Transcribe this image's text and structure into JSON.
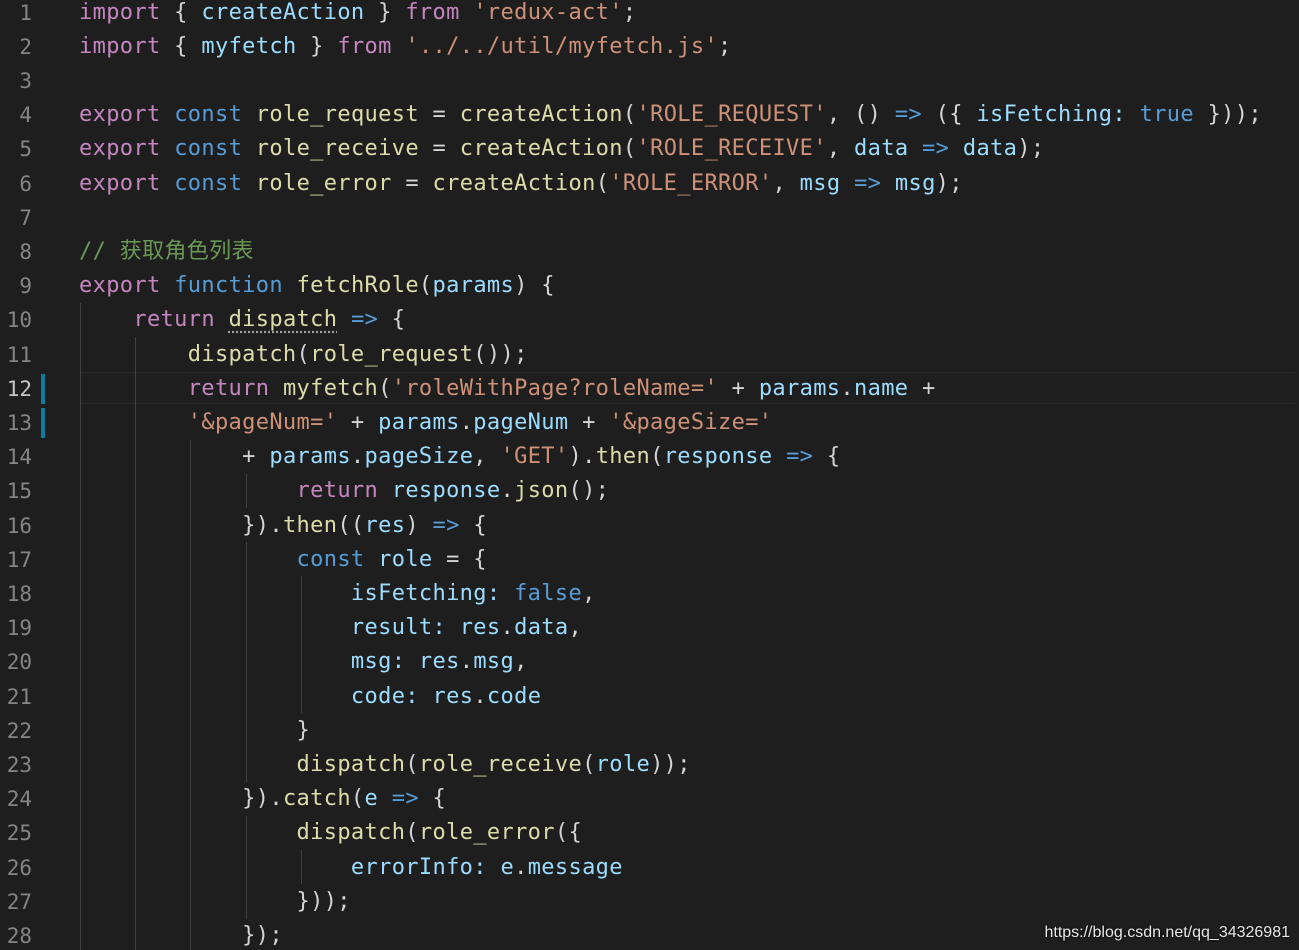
{
  "editor": {
    "language": "javascript",
    "theme_colors": {
      "background": "#1e1e1e",
      "line_number": "#858585",
      "keyword": "#c586c0",
      "storage": "#569cd6",
      "function": "#dcdcaa",
      "variable": "#9cdcfe",
      "string": "#ce9178",
      "comment": "#6a9955",
      "punctuation": "#d4d4d4",
      "modified_marker": "#0c7d9d"
    },
    "active_line": 12,
    "modified_lines": [
      12,
      13
    ],
    "lines": [
      {
        "n": "1",
        "tokens": [
          [
            "kw",
            "import"
          ],
          [
            "pun",
            " { "
          ],
          [
            "var",
            "createAction"
          ],
          [
            "pun",
            " } "
          ],
          [
            "kw",
            "from"
          ],
          [
            "pun",
            " "
          ],
          [
            "str",
            "'redux-act'"
          ],
          [
            "pun",
            ";"
          ]
        ]
      },
      {
        "n": "2",
        "tokens": [
          [
            "kw",
            "import"
          ],
          [
            "pun",
            " { "
          ],
          [
            "var",
            "myfetch"
          ],
          [
            "pun",
            " } "
          ],
          [
            "kw",
            "from"
          ],
          [
            "pun",
            " "
          ],
          [
            "str",
            "'../../util/myfetch.js'"
          ],
          [
            "pun",
            ";"
          ]
        ]
      },
      {
        "n": "3",
        "tokens": []
      },
      {
        "n": "4",
        "tokens": [
          [
            "kw",
            "export"
          ],
          [
            "pun",
            " "
          ],
          [
            "st",
            "const"
          ],
          [
            "pun",
            " "
          ],
          [
            "fn",
            "role_request"
          ],
          [
            "pun",
            " = "
          ],
          [
            "fn",
            "createAction"
          ],
          [
            "pun",
            "("
          ],
          [
            "str",
            "'ROLE_REQUEST'"
          ],
          [
            "pun",
            ", () "
          ],
          [
            "st",
            "=>"
          ],
          [
            "pun",
            " ({ "
          ],
          [
            "var",
            "isFetching"
          ],
          [
            "var",
            ":"
          ],
          [
            "pun",
            " "
          ],
          [
            "st",
            "true"
          ],
          [
            "pun",
            " }));"
          ]
        ]
      },
      {
        "n": "5",
        "tokens": [
          [
            "kw",
            "export"
          ],
          [
            "pun",
            " "
          ],
          [
            "st",
            "const"
          ],
          [
            "pun",
            " "
          ],
          [
            "fn",
            "role_receive"
          ],
          [
            "pun",
            " = "
          ],
          [
            "fn",
            "createAction"
          ],
          [
            "pun",
            "("
          ],
          [
            "str",
            "'ROLE_RECEIVE'"
          ],
          [
            "pun",
            ", "
          ],
          [
            "var",
            "data"
          ],
          [
            "pun",
            " "
          ],
          [
            "st",
            "=>"
          ],
          [
            "pun",
            " "
          ],
          [
            "var",
            "data"
          ],
          [
            "pun",
            ");"
          ]
        ]
      },
      {
        "n": "6",
        "tokens": [
          [
            "kw",
            "export"
          ],
          [
            "pun",
            " "
          ],
          [
            "st",
            "const"
          ],
          [
            "pun",
            " "
          ],
          [
            "fn",
            "role_error"
          ],
          [
            "pun",
            " = "
          ],
          [
            "fn",
            "createAction"
          ],
          [
            "pun",
            "("
          ],
          [
            "str",
            "'ROLE_ERROR'"
          ],
          [
            "pun",
            ", "
          ],
          [
            "var",
            "msg"
          ],
          [
            "pun",
            " "
          ],
          [
            "st",
            "=>"
          ],
          [
            "pun",
            " "
          ],
          [
            "var",
            "msg"
          ],
          [
            "pun",
            ");"
          ]
        ]
      },
      {
        "n": "7",
        "tokens": []
      },
      {
        "n": "8",
        "tokens": [
          [
            "cmt",
            "// 获取角色列表"
          ]
        ]
      },
      {
        "n": "9",
        "tokens": [
          [
            "kw",
            "export"
          ],
          [
            "pun",
            " "
          ],
          [
            "st",
            "function"
          ],
          [
            "pun",
            " "
          ],
          [
            "fn",
            "fetchRole"
          ],
          [
            "pun",
            "("
          ],
          [
            "var",
            "params"
          ],
          [
            "pun",
            ") {"
          ]
        ]
      },
      {
        "n": "10",
        "tokens": [
          [
            "pun",
            "    "
          ],
          [
            "kw",
            "return"
          ],
          [
            "pun",
            " "
          ],
          [
            "fn sq",
            "dispatch"
          ],
          [
            "pun",
            " "
          ],
          [
            "st",
            "=>"
          ],
          [
            "pun",
            " {"
          ]
        ]
      },
      {
        "n": "11",
        "tokens": [
          [
            "pun",
            "        "
          ],
          [
            "fn",
            "dispatch"
          ],
          [
            "pun",
            "("
          ],
          [
            "fn",
            "role_request"
          ],
          [
            "pun",
            "());"
          ]
        ]
      },
      {
        "n": "12",
        "tokens": [
          [
            "pun",
            "        "
          ],
          [
            "kw",
            "return"
          ],
          [
            "pun",
            " "
          ],
          [
            "fn",
            "myfetch"
          ],
          [
            "pun",
            "("
          ],
          [
            "str",
            "'roleWithPage?roleName='"
          ],
          [
            "pun",
            " + "
          ],
          [
            "var",
            "params"
          ],
          [
            "pun",
            "."
          ],
          [
            "var",
            "name"
          ],
          [
            "pun",
            " +"
          ]
        ]
      },
      {
        "n": "13",
        "tokens": [
          [
            "pun",
            "        "
          ],
          [
            "str",
            "'&pageNum='"
          ],
          [
            "pun",
            " + "
          ],
          [
            "var",
            "params"
          ],
          [
            "pun",
            "."
          ],
          [
            "var",
            "pageNum"
          ],
          [
            "pun",
            " + "
          ],
          [
            "str",
            "'&pageSize='"
          ]
        ]
      },
      {
        "n": "14",
        "tokens": [
          [
            "pun",
            "            + "
          ],
          [
            "var",
            "params"
          ],
          [
            "pun",
            "."
          ],
          [
            "var",
            "pageSize"
          ],
          [
            "pun",
            ", "
          ],
          [
            "str",
            "'GET'"
          ],
          [
            "pun",
            ")."
          ],
          [
            "fn",
            "then"
          ],
          [
            "pun",
            "("
          ],
          [
            "var",
            "response"
          ],
          [
            "pun",
            " "
          ],
          [
            "st",
            "=>"
          ],
          [
            "pun",
            " {"
          ]
        ]
      },
      {
        "n": "15",
        "tokens": [
          [
            "pun",
            "                "
          ],
          [
            "kw",
            "return"
          ],
          [
            "pun",
            " "
          ],
          [
            "var",
            "response"
          ],
          [
            "pun",
            "."
          ],
          [
            "fn",
            "json"
          ],
          [
            "pun",
            "();"
          ]
        ]
      },
      {
        "n": "16",
        "tokens": [
          [
            "pun",
            "            })."
          ],
          [
            "fn",
            "then"
          ],
          [
            "pun",
            "(("
          ],
          [
            "var",
            "res"
          ],
          [
            "pun",
            ") "
          ],
          [
            "st",
            "=>"
          ],
          [
            "pun",
            " {"
          ]
        ]
      },
      {
        "n": "17",
        "tokens": [
          [
            "pun",
            "                "
          ],
          [
            "st",
            "const"
          ],
          [
            "pun",
            " "
          ],
          [
            "var",
            "role"
          ],
          [
            "pun",
            " = {"
          ]
        ]
      },
      {
        "n": "18",
        "tokens": [
          [
            "pun",
            "                    "
          ],
          [
            "var",
            "isFetching"
          ],
          [
            "var",
            ":"
          ],
          [
            "pun",
            " "
          ],
          [
            "st",
            "false"
          ],
          [
            "pun",
            ","
          ]
        ]
      },
      {
        "n": "19",
        "tokens": [
          [
            "pun",
            "                    "
          ],
          [
            "var",
            "result"
          ],
          [
            "var",
            ":"
          ],
          [
            "pun",
            " "
          ],
          [
            "var",
            "res"
          ],
          [
            "pun",
            "."
          ],
          [
            "var",
            "data"
          ],
          [
            "pun",
            ","
          ]
        ]
      },
      {
        "n": "20",
        "tokens": [
          [
            "pun",
            "                    "
          ],
          [
            "var",
            "msg"
          ],
          [
            "var",
            ":"
          ],
          [
            "pun",
            " "
          ],
          [
            "var",
            "res"
          ],
          [
            "pun",
            "."
          ],
          [
            "var",
            "msg"
          ],
          [
            "pun",
            ","
          ]
        ]
      },
      {
        "n": "21",
        "tokens": [
          [
            "pun",
            "                    "
          ],
          [
            "var",
            "code"
          ],
          [
            "var",
            ":"
          ],
          [
            "pun",
            " "
          ],
          [
            "var",
            "res"
          ],
          [
            "pun",
            "."
          ],
          [
            "var",
            "code"
          ]
        ]
      },
      {
        "n": "22",
        "tokens": [
          [
            "pun",
            "                }"
          ]
        ]
      },
      {
        "n": "23",
        "tokens": [
          [
            "pun",
            "                "
          ],
          [
            "fn",
            "dispatch"
          ],
          [
            "pun",
            "("
          ],
          [
            "fn",
            "role_receive"
          ],
          [
            "pun",
            "("
          ],
          [
            "var",
            "role"
          ],
          [
            "pun",
            "));"
          ]
        ]
      },
      {
        "n": "24",
        "tokens": [
          [
            "pun",
            "            })."
          ],
          [
            "fn",
            "catch"
          ],
          [
            "pun",
            "("
          ],
          [
            "var",
            "e"
          ],
          [
            "pun",
            " "
          ],
          [
            "st",
            "=>"
          ],
          [
            "pun",
            " {"
          ]
        ]
      },
      {
        "n": "25",
        "tokens": [
          [
            "pun",
            "                "
          ],
          [
            "fn",
            "dispatch"
          ],
          [
            "pun",
            "("
          ],
          [
            "fn",
            "role_error"
          ],
          [
            "pun",
            "({"
          ]
        ]
      },
      {
        "n": "26",
        "tokens": [
          [
            "pun",
            "                    "
          ],
          [
            "var",
            "errorInfo"
          ],
          [
            "var",
            ":"
          ],
          [
            "pun",
            " "
          ],
          [
            "var",
            "e"
          ],
          [
            "pun",
            "."
          ],
          [
            "var",
            "message"
          ]
        ]
      },
      {
        "n": "27",
        "tokens": [
          [
            "pun",
            "                }));"
          ]
        ]
      },
      {
        "n": "28",
        "tokens": [
          [
            "pun",
            "            });"
          ]
        ]
      }
    ]
  },
  "watermark": {
    "text": "https://blog.csdn.net/qq_34326981"
  }
}
